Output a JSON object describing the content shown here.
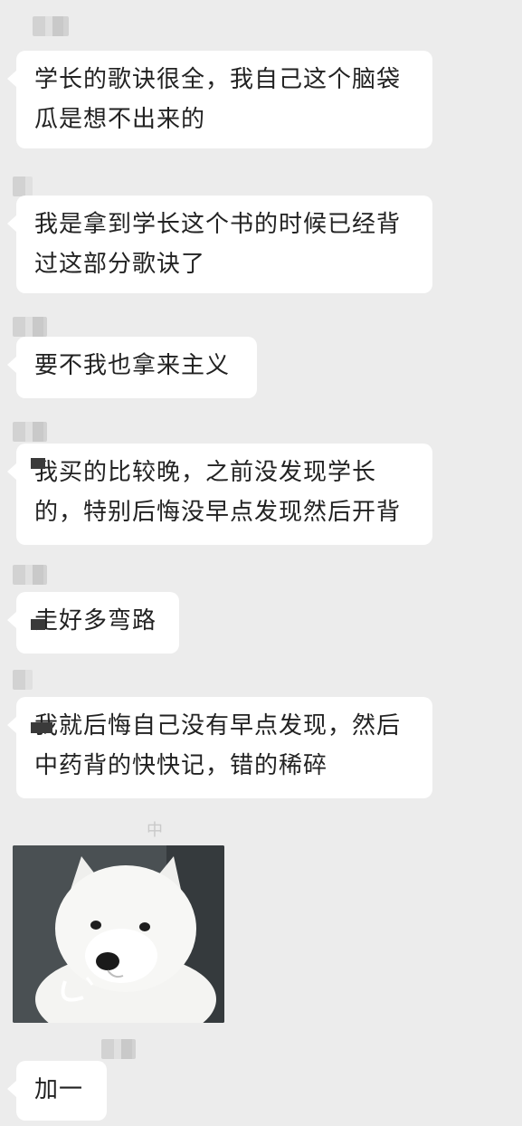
{
  "chat": {
    "messages": [
      {
        "text": "学长的歌诀很全，我自己这个脑袋\n瓜是想不出来的"
      },
      {
        "text": "我是拿到学长这个书的时候已经背\n过这部分歌诀了"
      },
      {
        "text": "要不我也拿来主义"
      },
      {
        "text": "我买的比较晚，之前没发现学长\n的，特别后悔没早点发现然后开背"
      },
      {
        "text": "走好多弯路"
      },
      {
        "text": "我就后悔自己没有早点发现，然后\n中药背的快快记，错的稀碎"
      },
      {
        "text": "加一"
      }
    ],
    "faint_labels": [
      "中"
    ],
    "sticker": {
      "subject": "white-samoyed-puppy"
    }
  },
  "colors": {
    "background": "#ececec",
    "bubble": "#ffffff",
    "text": "#222222"
  }
}
